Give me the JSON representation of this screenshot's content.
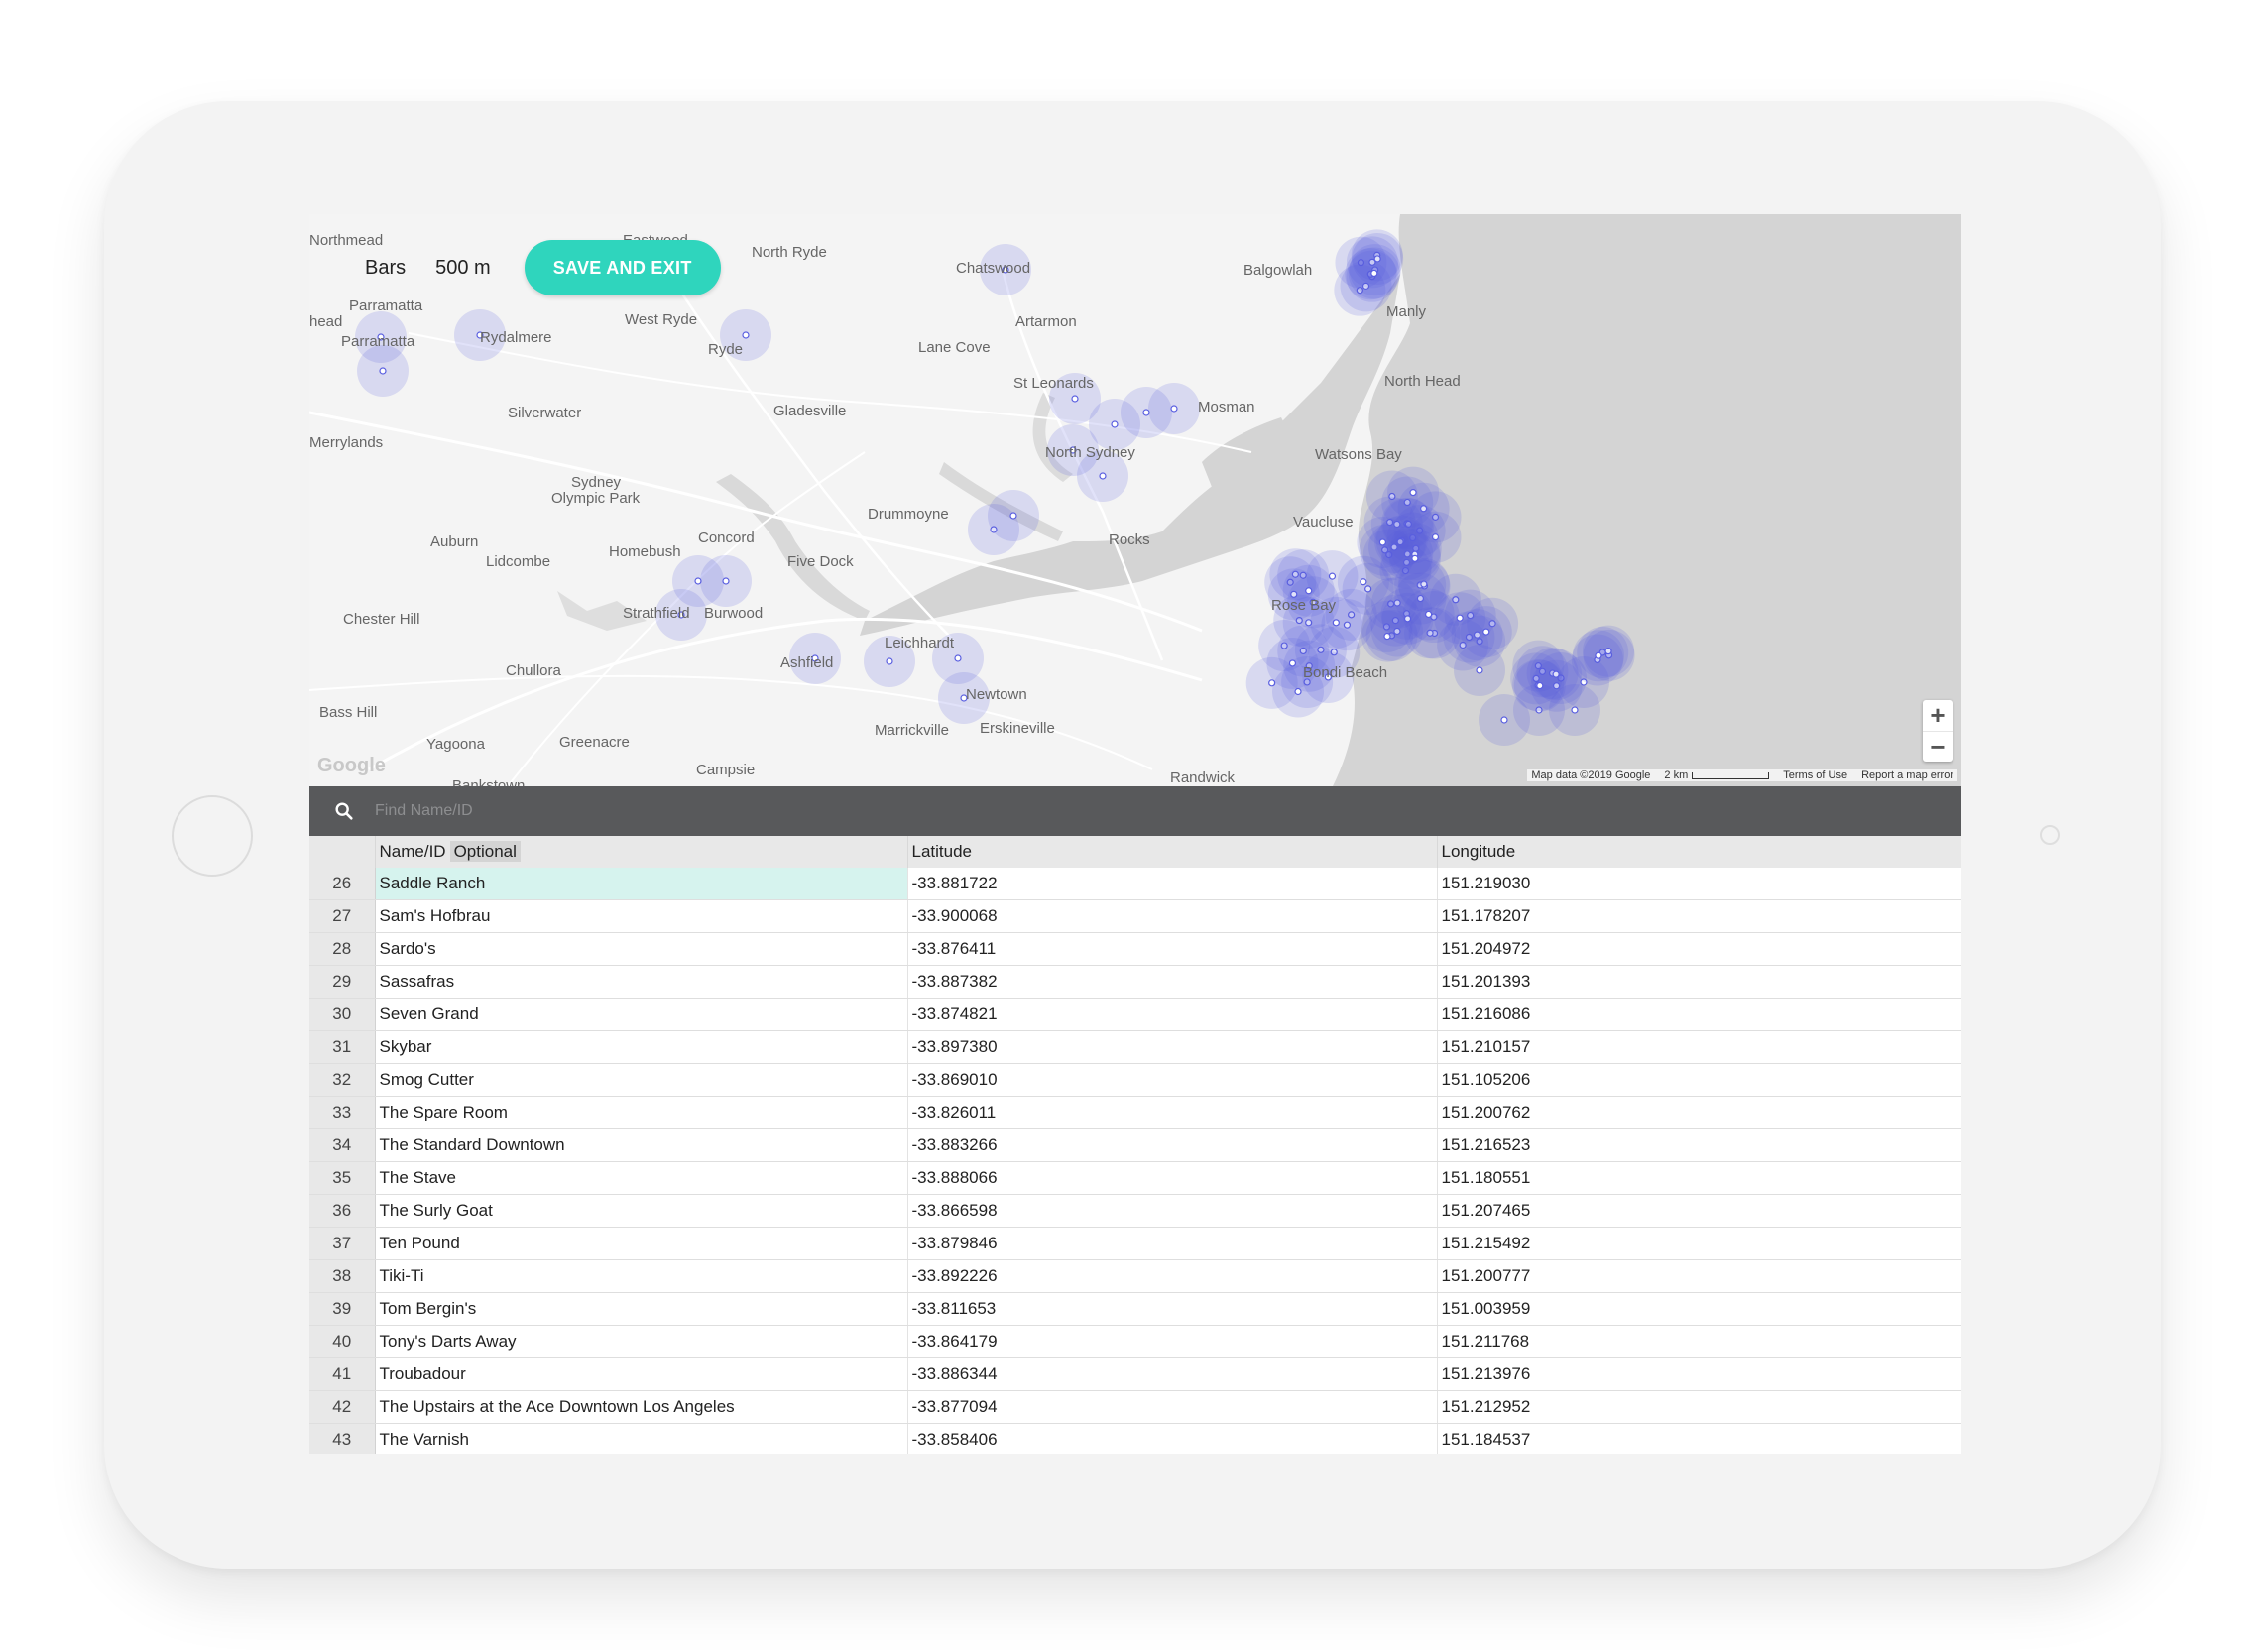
{
  "toolbar": {
    "category": "Bars",
    "radius": "500 m",
    "save_label": "SAVE AND EXIT"
  },
  "map": {
    "places": [
      {
        "name": "Northmead"
      },
      {
        "name": "Eastwood"
      },
      {
        "name": "North Ryde"
      },
      {
        "name": "Chatswood"
      },
      {
        "name": "Balgowlah"
      },
      {
        "name": "Manly"
      },
      {
        "name": "Parramatta"
      },
      {
        "name": "head"
      },
      {
        "name": "Parramatta"
      },
      {
        "name": "Rydalmere"
      },
      {
        "name": "West Ryde"
      },
      {
        "name": "Ryde"
      },
      {
        "name": "Artarmon"
      },
      {
        "name": "Lane Cove"
      },
      {
        "name": "North Head"
      },
      {
        "name": "St Leonards"
      },
      {
        "name": "Silverwater"
      },
      {
        "name": "Gladesville"
      },
      {
        "name": "Mosman"
      },
      {
        "name": "Merrylands"
      },
      {
        "name": "North Sydney"
      },
      {
        "name": "Watsons Bay"
      },
      {
        "name": "Sydney"
      },
      {
        "name": "Olympic Park"
      },
      {
        "name": "Drummoyne"
      },
      {
        "name": "Vaucluse"
      },
      {
        "name": "Auburn"
      },
      {
        "name": "Lidcombe"
      },
      {
        "name": "Homebush"
      },
      {
        "name": "Concord"
      },
      {
        "name": "Five Dock"
      },
      {
        "name": "Rocks"
      },
      {
        "name": "Rose Bay"
      },
      {
        "name": "Chester Hill"
      },
      {
        "name": "Strathfield"
      },
      {
        "name": "Burwood"
      },
      {
        "name": "Leichhardt"
      },
      {
        "name": "Ashfield"
      },
      {
        "name": "Bondi Beach"
      },
      {
        "name": "Chullora"
      },
      {
        "name": "Bass Hill"
      },
      {
        "name": "Newtown"
      },
      {
        "name": "Marrickville"
      },
      {
        "name": "Erskineville"
      },
      {
        "name": "Yagoona"
      },
      {
        "name": "Greenacre"
      },
      {
        "name": "Campsie"
      },
      {
        "name": "Randwick"
      },
      {
        "name": "Bankstown"
      }
    ],
    "logo": "Google",
    "attribution": {
      "map_data": "Map data ©2019 Google",
      "scale": "2 km",
      "terms": "Terms of Use",
      "report": "Report a map error"
    },
    "zoom_in": "+",
    "zoom_out": "−"
  },
  "search": {
    "placeholder": "Find Name/ID"
  },
  "table": {
    "columns": {
      "name": "Name/ID",
      "optional": "Optional",
      "lat": "Latitude",
      "lng": "Longitude"
    },
    "rows": [
      {
        "idx": "26",
        "name": "Saddle Ranch",
        "lat": "-33.881722",
        "lng": "151.219030",
        "selected": true
      },
      {
        "idx": "27",
        "name": "Sam's Hofbrau",
        "lat": "-33.900068",
        "lng": "151.178207"
      },
      {
        "idx": "28",
        "name": "Sardo's",
        "lat": "-33.876411",
        "lng": "151.204972"
      },
      {
        "idx": "29",
        "name": "Sassafras",
        "lat": "-33.887382",
        "lng": "151.201393"
      },
      {
        "idx": "30",
        "name": "Seven Grand",
        "lat": "-33.874821",
        "lng": "151.216086"
      },
      {
        "idx": "31",
        "name": "Skybar",
        "lat": "-33.897380",
        "lng": "151.210157"
      },
      {
        "idx": "32",
        "name": "Smog Cutter",
        "lat": "-33.869010",
        "lng": "151.105206"
      },
      {
        "idx": "33",
        "name": "The Spare Room",
        "lat": "-33.826011",
        "lng": "151.200762"
      },
      {
        "idx": "34",
        "name": "The Standard Downtown",
        "lat": "-33.883266",
        "lng": "151.216523"
      },
      {
        "idx": "35",
        "name": "The Stave",
        "lat": "-33.888066",
        "lng": "151.180551"
      },
      {
        "idx": "36",
        "name": "The Surly Goat",
        "lat": "-33.866598",
        "lng": "151.207465"
      },
      {
        "idx": "37",
        "name": "Ten Pound",
        "lat": "-33.879846",
        "lng": "151.215492"
      },
      {
        "idx": "38",
        "name": "Tiki-Ti",
        "lat": "-33.892226",
        "lng": "151.200777"
      },
      {
        "idx": "39",
        "name": "Tom Bergin's",
        "lat": "-33.811653",
        "lng": "151.003959"
      },
      {
        "idx": "40",
        "name": "Tony's Darts Away",
        "lat": "-33.864179",
        "lng": "151.211768"
      },
      {
        "idx": "41",
        "name": "Troubadour",
        "lat": "-33.886344",
        "lng": "151.213976"
      },
      {
        "idx": "42",
        "name": "The Upstairs at the Ace Downtown Los Angeles",
        "lat": "-33.877094",
        "lng": "151.212952"
      },
      {
        "idx": "43",
        "name": "The Varnish",
        "lat": "-33.858406",
        "lng": "151.184537"
      }
    ]
  },
  "colors": {
    "accent": "#2fd5bd",
    "marker": "#5a5fe0",
    "water": "#d6d6d6",
    "search_bar": "#58595b",
    "selected_row": "#d6f3ee"
  },
  "icons": {
    "search": "search-icon",
    "zoom_in": "plus-icon",
    "zoom_out": "minus-icon"
  }
}
